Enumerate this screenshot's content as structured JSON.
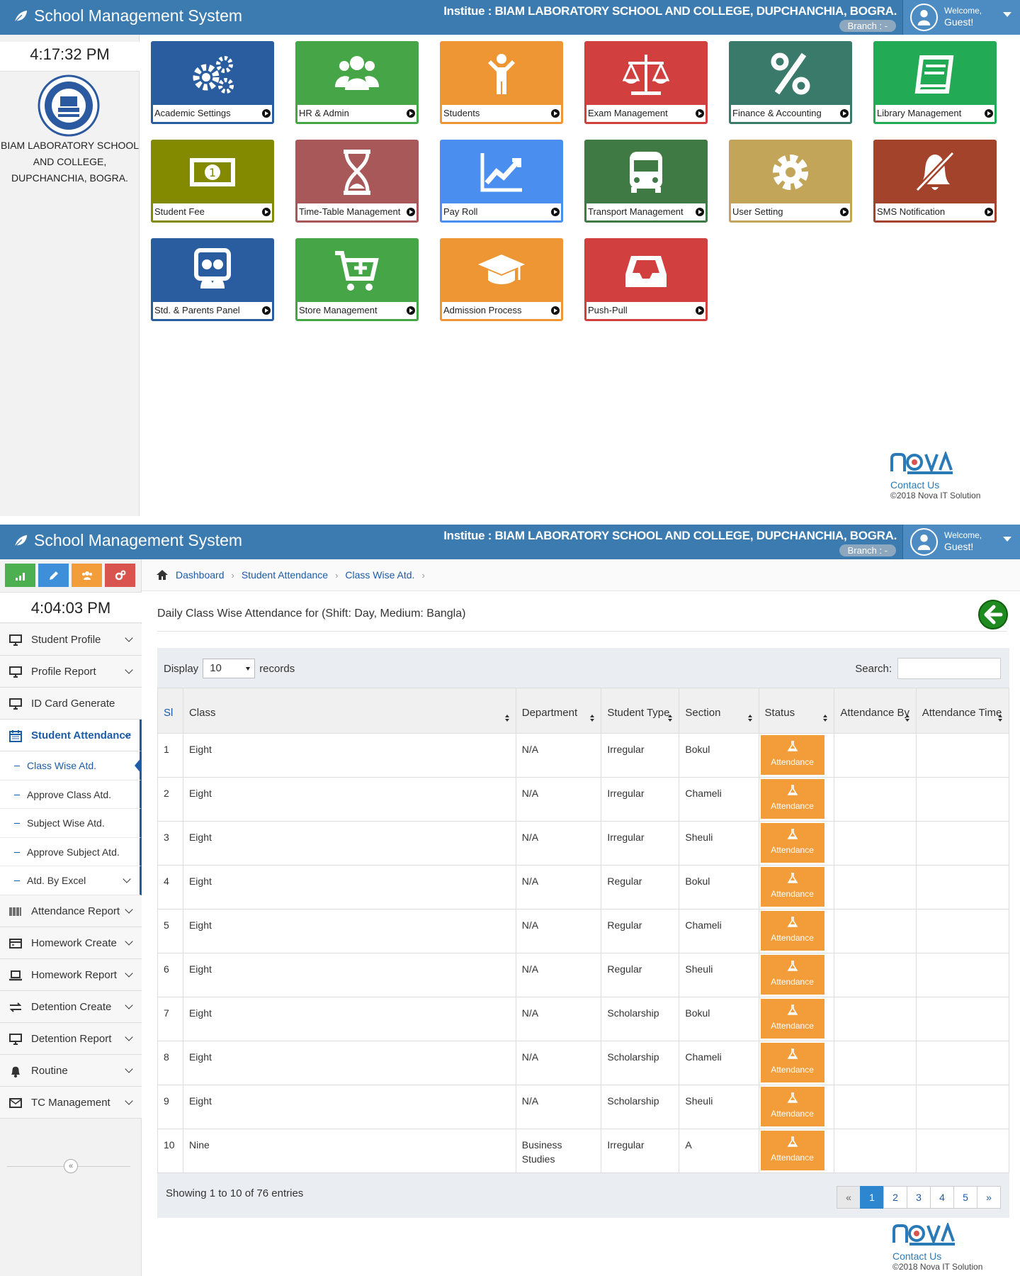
{
  "header": {
    "app_title": "School Management System",
    "institute": "Institue : BIAM LABORATORY SCHOOL AND COLLEGE, DUPCHANCHIA, BOGRA.",
    "branch": "Branch : -",
    "welcome": "Welcome,",
    "user": "Guest!"
  },
  "screen1": {
    "clock": "4:17:32 PM",
    "school_name": "BIAM LABORATORY SCHOOL AND COLLEGE, DUPCHANCHIA, BOGRA.",
    "tiles": [
      {
        "label": "Academic Settings",
        "color": "#2a5d9f",
        "border": "#2a5d9f",
        "icon": "gears-icon"
      },
      {
        "label": "HR & Admin",
        "color": "#46a546",
        "border": "#46a546",
        "icon": "users-icon"
      },
      {
        "label": "Students",
        "color": "#ee9633",
        "border": "#ee9633",
        "icon": "child-icon"
      },
      {
        "label": "Exam Management",
        "color": "#d13f3f",
        "border": "#d13f3f",
        "icon": "balance-scale-icon"
      },
      {
        "label": "Finance & Accounting",
        "color": "#3a7a6a",
        "border": "#3a7a6a",
        "icon": "percent-icon"
      },
      {
        "label": "Library Management",
        "color": "#22aa55",
        "border": "#22aa55",
        "icon": "book-icon"
      },
      {
        "label": "Student Fee",
        "color": "#838a00",
        "border": "#838a00",
        "icon": "money-icon"
      },
      {
        "label": "Time-Table Management",
        "color": "#a85858",
        "border": "#a85858",
        "icon": "hourglass-icon"
      },
      {
        "label": "Pay Roll",
        "color": "#4a8ff0",
        "border": "#4a8ff0",
        "icon": "line-chart-icon"
      },
      {
        "label": "Transport Management",
        "color": "#3f7a44",
        "border": "#3f7a44",
        "icon": "bus-icon"
      },
      {
        "label": "User Setting",
        "color": "#c2a559",
        "border": "#c2a559",
        "icon": "gear-icon"
      },
      {
        "label": "SMS Notification",
        "color": "#a4432b",
        "border": "#a4432b",
        "icon": "bell-slash-icon"
      },
      {
        "label": "Std. & Parents Panel",
        "color": "#2a5d9f",
        "border": "#2a5d9f",
        "icon": "parents-icon"
      },
      {
        "label": "Store Management",
        "color": "#46a546",
        "border": "#46a546",
        "icon": "cart-plus-icon"
      },
      {
        "label": "Admission Process",
        "color": "#ee9633",
        "border": "#ee9633",
        "icon": "graduation-cap-icon"
      },
      {
        "label": "Push-Pull",
        "color": "#d13f3f",
        "border": "#d13f3f",
        "icon": "inbox-icon"
      }
    ],
    "footer": {
      "contact": "Contact Us",
      "copyright": "©2018 Nova IT Solution"
    }
  },
  "screen2": {
    "clock": "4:04:03 PM",
    "quick_buttons": [
      {
        "icon": "signal-icon",
        "color": "#4caf50"
      },
      {
        "icon": "pencil-icon",
        "color": "#3c8fd8"
      },
      {
        "icon": "users-icon",
        "color": "#f39c3a"
      },
      {
        "icon": "cogs-icon",
        "color": "#d9534f"
      }
    ],
    "menu": [
      {
        "label": "Student Profile",
        "icon": "desktop-icon"
      },
      {
        "label": "Profile Report",
        "icon": "desktop-icon"
      },
      {
        "label": "ID Card Generate",
        "icon": "desktop-icon"
      },
      {
        "label": "Student Attendance",
        "icon": "calendar-icon",
        "active": true
      },
      {
        "label": "Attendance Report",
        "icon": "barcode-icon"
      },
      {
        "label": "Homework Create",
        "icon": "card-icon"
      },
      {
        "label": "Homework Report",
        "icon": "laptop-icon"
      },
      {
        "label": "Detention Create",
        "icon": "exchange-icon"
      },
      {
        "label": "Detention Report",
        "icon": "desktop-icon"
      },
      {
        "label": "Routine",
        "icon": "bell-icon"
      },
      {
        "label": "TC Management",
        "icon": "envelope-icon"
      }
    ],
    "submenu": [
      "Class Wise Atd.",
      "Approve Class Atd.",
      "Subject Wise Atd.",
      "Approve Subject Atd.",
      "Atd. By Excel"
    ],
    "breadcrumb": [
      "Dashboard",
      "Student Attendance",
      "Class Wise Atd."
    ],
    "page_title": "Daily Class Wise Attendance for (Shift: Day, Medium: Bangla)",
    "display_label": "Display",
    "display_value": "10",
    "records_label": "records",
    "search_label": "Search:",
    "columns": [
      "Sl",
      "Class",
      "Department",
      "Student Type",
      "Section",
      "Status",
      "Attendance By",
      "Attendance Time"
    ],
    "attendance_button": "Attendance",
    "rows": [
      {
        "sl": "1",
        "class": "Eight",
        "dept": "N/A",
        "type": "Irregular",
        "section": "Bokul"
      },
      {
        "sl": "2",
        "class": "Eight",
        "dept": "N/A",
        "type": "Irregular",
        "section": "Chameli"
      },
      {
        "sl": "3",
        "class": "Eight",
        "dept": "N/A",
        "type": "Irregular",
        "section": "Sheuli"
      },
      {
        "sl": "4",
        "class": "Eight",
        "dept": "N/A",
        "type": "Regular",
        "section": "Bokul"
      },
      {
        "sl": "5",
        "class": "Eight",
        "dept": "N/A",
        "type": "Regular",
        "section": "Chameli"
      },
      {
        "sl": "6",
        "class": "Eight",
        "dept": "N/A",
        "type": "Regular",
        "section": "Sheuli"
      },
      {
        "sl": "7",
        "class": "Eight",
        "dept": "N/A",
        "type": "Scholarship",
        "section": "Bokul"
      },
      {
        "sl": "8",
        "class": "Eight",
        "dept": "N/A",
        "type": "Scholarship",
        "section": "Chameli"
      },
      {
        "sl": "9",
        "class": "Eight",
        "dept": "N/A",
        "type": "Scholarship",
        "section": "Sheuli"
      },
      {
        "sl": "10",
        "class": "Nine",
        "dept": "Business Studies",
        "type": "Irregular",
        "section": "A"
      }
    ],
    "showing": "Showing 1 to 10 of 76 entries",
    "pagination": [
      "«",
      "1",
      "2",
      "3",
      "4",
      "5",
      "»"
    ],
    "footer": {
      "contact": "Contact Us",
      "copyright": "©2018 Nova IT Solution"
    }
  }
}
